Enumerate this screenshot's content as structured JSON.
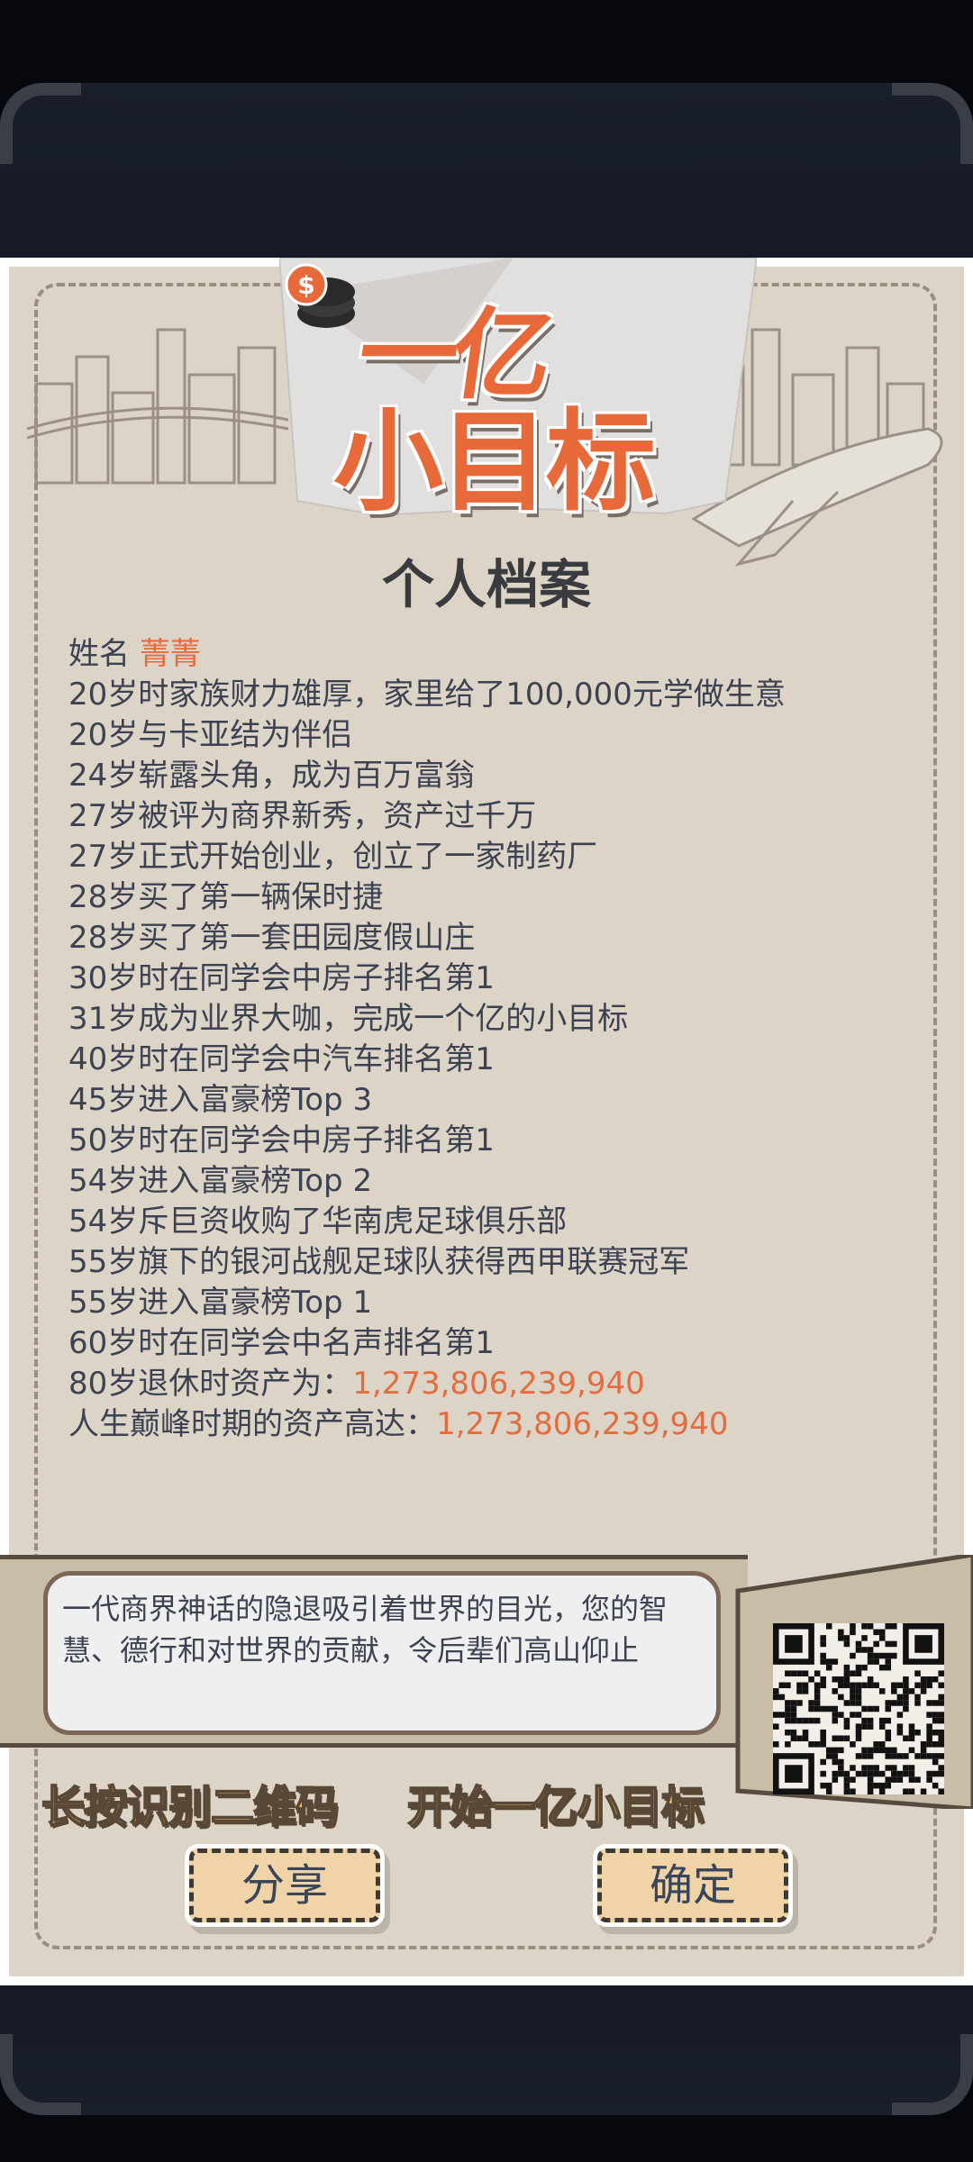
{
  "logo": {
    "line1": "一亿",
    "line2": "小目标",
    "coin_symbol": "$"
  },
  "title": "个人档案",
  "profile": {
    "name_label": "姓名",
    "name_value": "菁菁",
    "events": [
      "20岁时家族财力雄厚，家里给了100,000元学做生意",
      "20岁与卡亚结为伴侣",
      "24岁崭露头角，成为百万富翁",
      "27岁被评为商界新秀，资产过千万",
      "27岁正式开始创业，创立了一家制药厂",
      "28岁买了第一辆保时捷",
      "28岁买了第一套田园度假山庄",
      "30岁时在同学会中房子排名第1",
      "31岁成为业界大咖，完成一个亿的小目标",
      "40岁时在同学会中汽车排名第1",
      "45岁进入富豪榜Top 3",
      "50岁时在同学会中房子排名第1",
      "54岁进入富豪榜Top 2",
      "54岁斥巨资收购了华南虎足球俱乐部",
      "55岁旗下的银河战舰足球队获得西甲联赛冠军",
      "55岁进入富豪榜Top 1",
      "60岁时在同学会中名声排名第1"
    ],
    "retire_label": "80岁退休时资产为：",
    "retire_value": "1,273,806,239,940",
    "peak_label": "人生巅峰时期的资产高达：",
    "peak_value": "1,273,806,239,940"
  },
  "quote": "一代商界神话的隐退吸引着世界的目光，您的智慧、德行和对世界的贡献，令后辈们高山仰止",
  "slogan_left": "长按识别二维码",
  "slogan_right": "开始一亿小目标",
  "buttons": {
    "share": "分享",
    "confirm": "确定"
  },
  "colors": {
    "accent": "#e36d41",
    "paper": "#dcd4c6",
    "text": "#3d4252",
    "slogan": "#f4c36b"
  }
}
